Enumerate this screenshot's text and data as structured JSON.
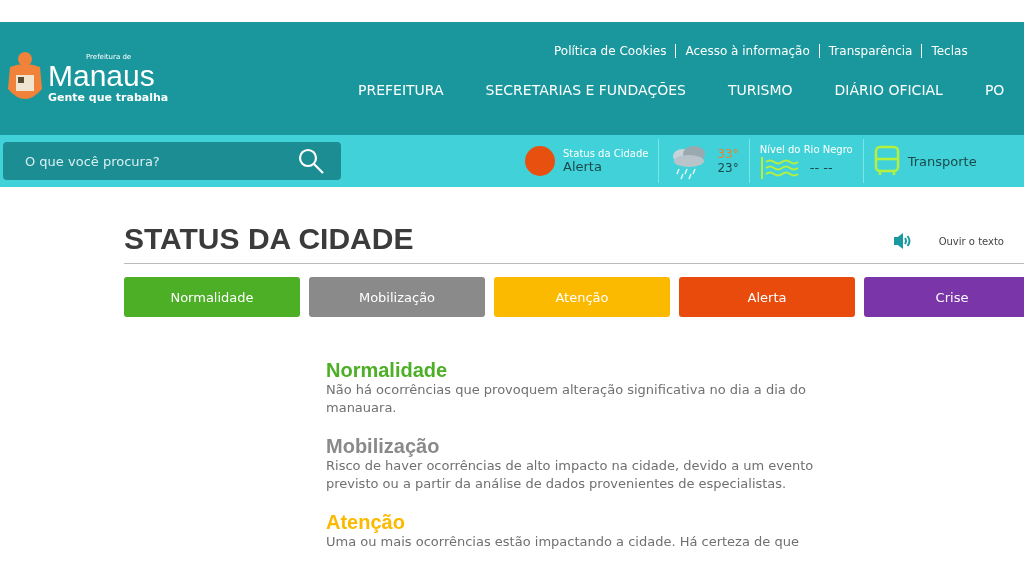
{
  "logo": {
    "prefix": "Prefeitura de",
    "name": "Manaus",
    "slogan": "Gente que trabalha"
  },
  "top_links": [
    "Política de Cookies",
    "Acesso à informação",
    "Transparência",
    "Teclas"
  ],
  "nav": [
    "PREFEITURA",
    "SECRETARIAS E FUNDAÇÕES",
    "TURISMO",
    "DIÁRIO OFICIAL",
    "PO"
  ],
  "search": {
    "placeholder": "O que você procura?"
  },
  "city_status": {
    "label": "Status da Cidade",
    "value": "Alerta",
    "color": "#e8500f"
  },
  "weather": {
    "max": "33°",
    "min": "23°"
  },
  "river": {
    "label": "Nível do Rio Negro",
    "value": "-- --"
  },
  "transport": {
    "label": "Transporte"
  },
  "page": {
    "title": "STATUS DA CIDADE",
    "listen": "Ouvir o texto"
  },
  "levels": [
    {
      "name": "Normalidade",
      "color": "#4caf25"
    },
    {
      "name": "Mobilização",
      "color": "#8a8a8a"
    },
    {
      "name": "Atenção",
      "color": "#fbb900"
    },
    {
      "name": "Alerta",
      "color": "#e84b0c"
    },
    {
      "name": "Crise",
      "color": "#7a35a8"
    }
  ],
  "descriptions": [
    {
      "name": "Normalidade",
      "color": "#4caf25",
      "text": "Não há ocorrências que provoquem alteração significativa no dia a dia do manauara."
    },
    {
      "name": "Mobilização",
      "color": "#8a8a8a",
      "text": "Risco de haver ocorrências de alto impacto na cidade, devido a um evento previsto ou a partir da análise de dados provenientes de especialistas."
    },
    {
      "name": "Atenção",
      "color": "#fbb900",
      "text": "Uma ou mais ocorrências estão impactando a cidade. Há certeza de que"
    }
  ]
}
